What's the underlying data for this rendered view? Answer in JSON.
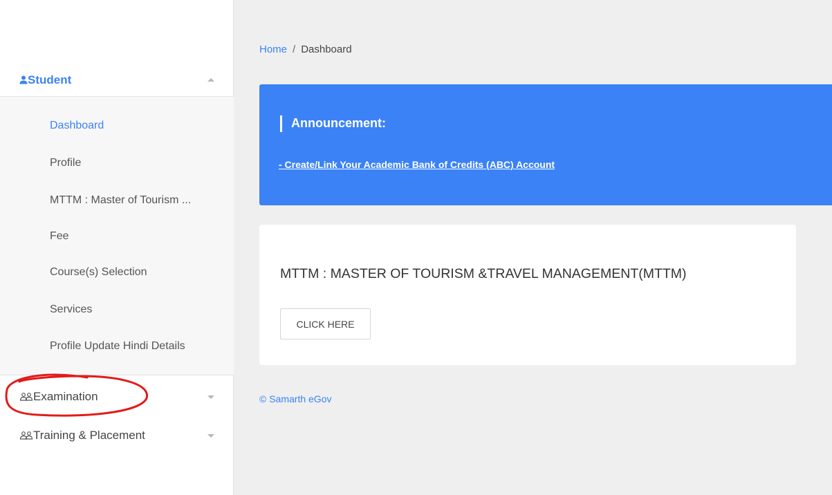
{
  "sidebar": {
    "student_label": "Student",
    "submenu": [
      {
        "label": "Dashboard",
        "active": true
      },
      {
        "label": "Profile"
      },
      {
        "label": "MTTM : Master of Tourism ..."
      },
      {
        "label": "Fee"
      },
      {
        "label": "Course(s) Selection"
      },
      {
        "label": "Services"
      },
      {
        "label": "Profile Update Hindi Details"
      }
    ],
    "examination_label": "Examination",
    "training_label": "Training & Placement"
  },
  "breadcrumb": {
    "home": "Home",
    "separator": "/",
    "current": "Dashboard"
  },
  "announcement": {
    "title": "Announcement:",
    "link": "- Create/Link Your Academic Bank of Credits (ABC) Account"
  },
  "program_card": {
    "title": "MTTM : MASTER OF TOURISM &TRAVEL MANAGEMENT(MTTM)",
    "button": "CLICK HERE"
  },
  "footer": {
    "text": "© Samarth eGov"
  },
  "colors": {
    "accent": "#3b82f6",
    "annotation": "#e21b1b"
  },
  "icons": {
    "student": "person-icon",
    "examination": "people-icon",
    "training": "people-icon"
  }
}
